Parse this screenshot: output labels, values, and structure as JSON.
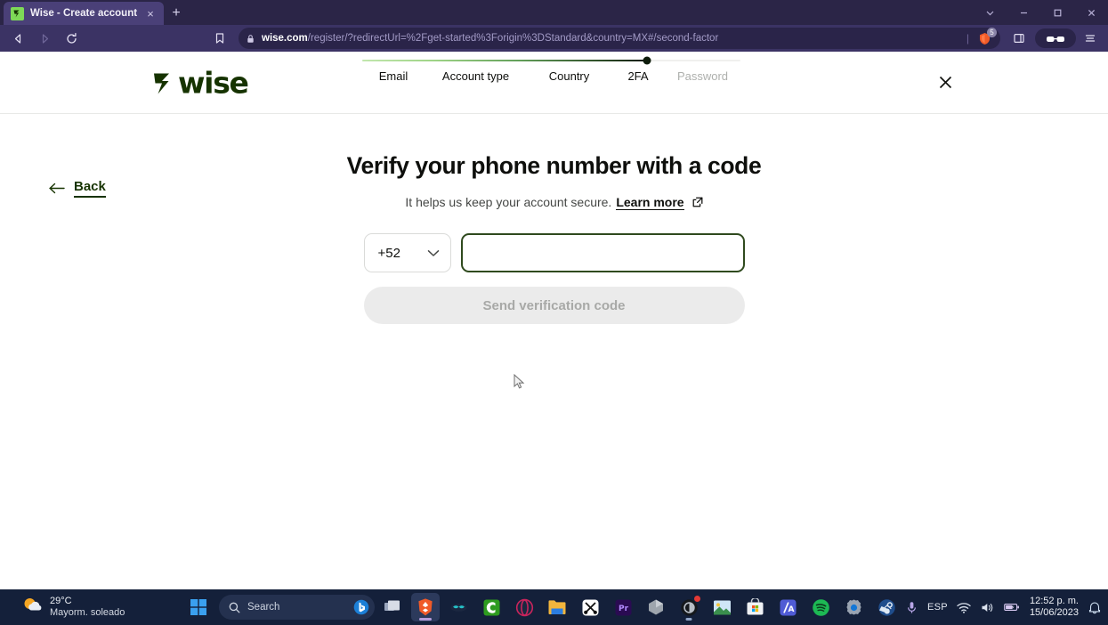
{
  "browser": {
    "tab": {
      "title": "Wise - Create account",
      "favicon": "wise-favicon",
      "close_label": "×"
    },
    "new_tab_label": "+",
    "window_controls": {
      "tab_search": "∨",
      "minimize": "–",
      "maximize": "□",
      "close": "×"
    },
    "toolbar": {
      "back": "back-arrow-icon",
      "forward": "forward-arrow-icon",
      "reload": "reload-icon",
      "bookmark": "bookmark-icon",
      "url_domain": "wise.com",
      "url_path": "/register/?redirectUrl=%2Fget-started%3Forigin%3DStandard&country=MX#/second-factor",
      "url_full": "wise.com/register/?redirectUrl=%2Fget-started%3Forigin%3DStandard&country=MX#/second-factor",
      "lock": "lock-icon",
      "shield_badge": "5",
      "sidebar": "sidebar-panel-icon",
      "brave_rewards": "brave-glasses-icon",
      "menu": "hamburger-menu-icon"
    }
  },
  "site": {
    "logo_text": "wise",
    "close_label": "×",
    "stepper": {
      "steps": [
        {
          "label": "Email",
          "state": "done"
        },
        {
          "label": "Account type",
          "state": "done"
        },
        {
          "label": "Country",
          "state": "done"
        },
        {
          "label": "2FA",
          "state": "current"
        },
        {
          "label": "Password",
          "state": "upcoming"
        }
      ],
      "progress_percent": 75
    },
    "back": {
      "label": "Back",
      "arrow": "←"
    },
    "main": {
      "headline": "Verify your phone number with a code",
      "subline_text": "It helps us keep your account secure.",
      "learn_more_label": "Learn more",
      "external_link_icon": "external-link-icon",
      "country_code": "+52",
      "phone_placeholder": "",
      "phone_value": "",
      "submit_label": "Send verification code"
    },
    "colors": {
      "brand_green": "#163300",
      "focus_border": "#2f4a1e",
      "disabled_button_bg": "#ebebeb",
      "disabled_button_text": "#a8a9a7"
    }
  },
  "taskbar": {
    "weather": {
      "temperature": "29°C",
      "description": "Mayorm. soleado",
      "icon": "sun-behind-cloud-icon"
    },
    "start_label": "start-button",
    "search_placeholder": "Search",
    "search_icon": "search-icon",
    "copilot_icon": "bing-copilot-icon",
    "apps": [
      {
        "name": "task-view",
        "icon": "task-view-icon",
        "state": "idle"
      },
      {
        "name": "brave-browser",
        "icon": "brave-lion-icon",
        "state": "active"
      },
      {
        "name": "discord",
        "icon": "discord-icon",
        "state": "idle"
      },
      {
        "name": "calculator",
        "icon": "letter-c-icon",
        "state": "idle"
      },
      {
        "name": "opera",
        "icon": "opera-icon",
        "state": "idle"
      },
      {
        "name": "file-explorer",
        "icon": "folder-icon",
        "state": "idle"
      },
      {
        "name": "capcut",
        "icon": "capcut-icon",
        "state": "idle"
      },
      {
        "name": "adobe-premiere-pro",
        "icon": "premiere-pr-icon",
        "state": "idle"
      },
      {
        "name": "3d-viewer",
        "icon": "cube-icon",
        "state": "idle"
      },
      {
        "name": "davinci-resolve",
        "icon": "resolve-icon",
        "state": "running",
        "badge": true
      },
      {
        "name": "photos",
        "icon": "photos-icon",
        "state": "idle"
      },
      {
        "name": "microsoft-store",
        "icon": "store-bag-icon",
        "state": "idle"
      },
      {
        "name": "media-app",
        "icon": "slash-a-icon",
        "state": "idle"
      },
      {
        "name": "spotify",
        "icon": "spotify-icon",
        "state": "idle"
      },
      {
        "name": "settings",
        "icon": "gear-icon",
        "state": "idle"
      },
      {
        "name": "steam",
        "icon": "steam-icon",
        "state": "idle"
      }
    ],
    "tray": {
      "chevron": "show-hidden-icons-chevron",
      "microphone": "microphone-icon",
      "language": "ESP",
      "wifi": "wifi-icon",
      "volume": "volume-icon",
      "battery": "battery-charging-icon",
      "time": "12:52 p. m.",
      "date": "15/06/2023",
      "notifications": "notification-bell-icon"
    }
  }
}
